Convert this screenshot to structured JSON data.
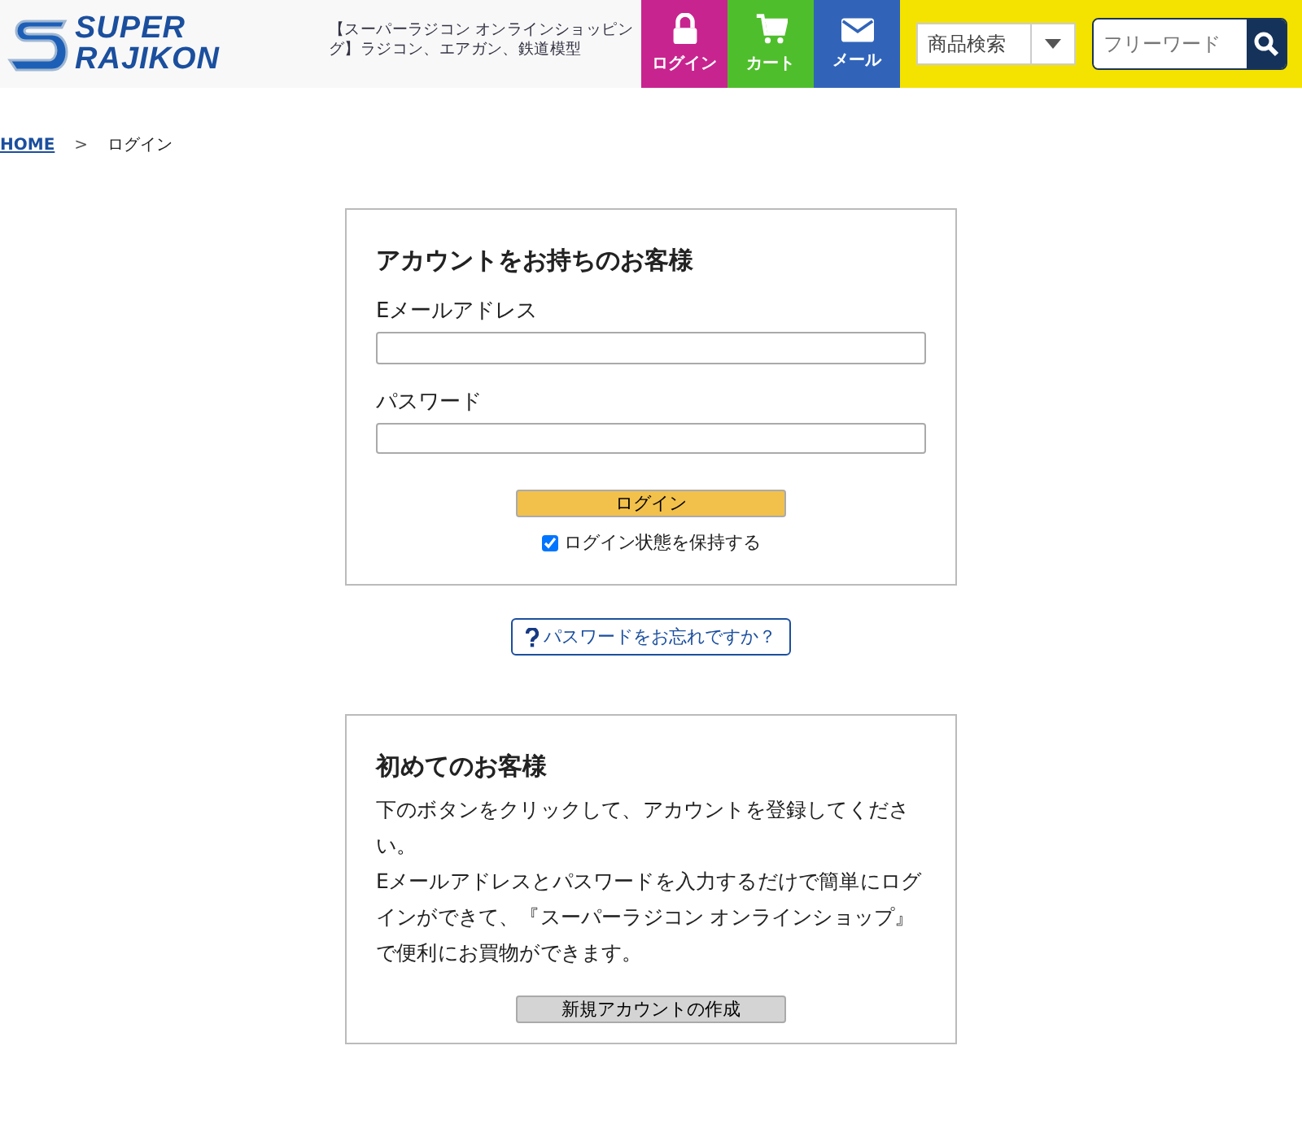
{
  "header": {
    "logo": [
      "SUPER",
      "RAJIKON"
    ],
    "tagline": "【スーパーラジコン オンラインショッピング】ラジコン、エアガン、鉄道模型",
    "nav": [
      {
        "kind": "lock",
        "label": "ログイン"
      },
      {
        "kind": "cart",
        "label": "カート"
      },
      {
        "kind": "mail",
        "label": "メール"
      }
    ],
    "category_select": "商品検索",
    "search": {
      "placeholder": "フリーワード"
    }
  },
  "breadcrumb": [
    "HOME",
    ">",
    "ログイン"
  ],
  "login": {
    "title": "アカウントをお持ちのお客様",
    "email_label": "Eメールアドレス",
    "password_label": "パスワード",
    "button": "ログイン",
    "remember": {
      "label": "ログイン状態を保持する",
      "checked": true
    }
  },
  "forgot_link": "パスワードをお忘れですか？",
  "signup": {
    "title": "初めてのお客様",
    "paragraphs": [
      "下のボタンをクリックして、アカウントを登録してください。",
      "Eメールアドレスとパスワードを入力するだけで簡単にログインができて、『スーパーラジコン オンラインショップ』で便利にお買物ができます。"
    ],
    "button": "新規アカウントの作成"
  }
}
